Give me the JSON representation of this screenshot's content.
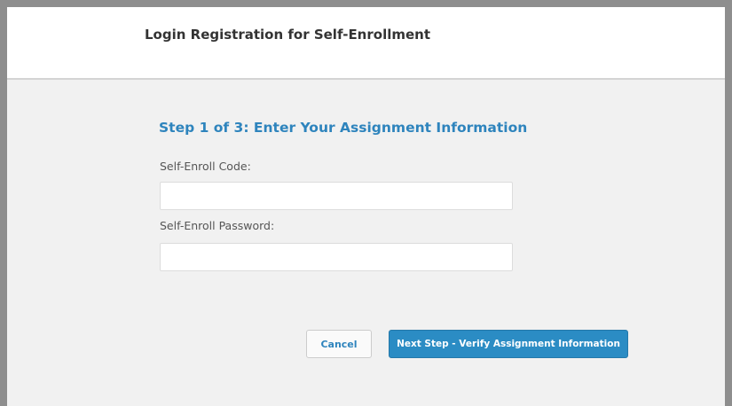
{
  "header": {
    "title": "Login Registration for Self-Enrollment"
  },
  "form": {
    "step_title": "Step 1 of 3: Enter Your Assignment Information",
    "code_label": "Self-Enroll Code:",
    "code_value": "",
    "code_placeholder": "",
    "password_label": "Self-Enroll Password:",
    "password_value": "",
    "password_placeholder": ""
  },
  "actions": {
    "cancel_label": "Cancel",
    "next_label": "Next Step - Verify Assignment Information"
  },
  "colors": {
    "accent": "#2e84bd",
    "primary_button": "#2b8cc4",
    "page_background": "#f1f1f1",
    "frame_border": "#8e8e8e"
  }
}
